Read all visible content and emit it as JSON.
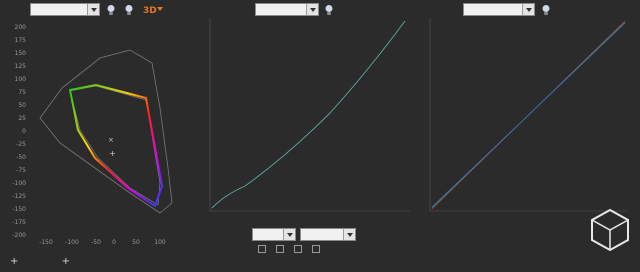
{
  "panel1": {
    "select_label": "",
    "y_ticks": [
      "200",
      "175",
      "150",
      "125",
      "100",
      "75",
      "50",
      "25",
      "0",
      "-25",
      "-50",
      "-75",
      "-100",
      "-125",
      "-150",
      "-175",
      "-200"
    ],
    "x_ticks": [
      "-150",
      "-100",
      "-50",
      "0",
      "50",
      "100"
    ]
  },
  "panel2": {
    "curve_select": "",
    "mode_select": "",
    "pcs_select": ""
  },
  "panel3": {
    "curve_select": ""
  },
  "bottom": {
    "add_label": "+",
    "check_items": [
      "",
      "",
      "",
      ""
    ]
  },
  "watermark": {
    "icon": "polyhedron-logo-icon"
  }
}
